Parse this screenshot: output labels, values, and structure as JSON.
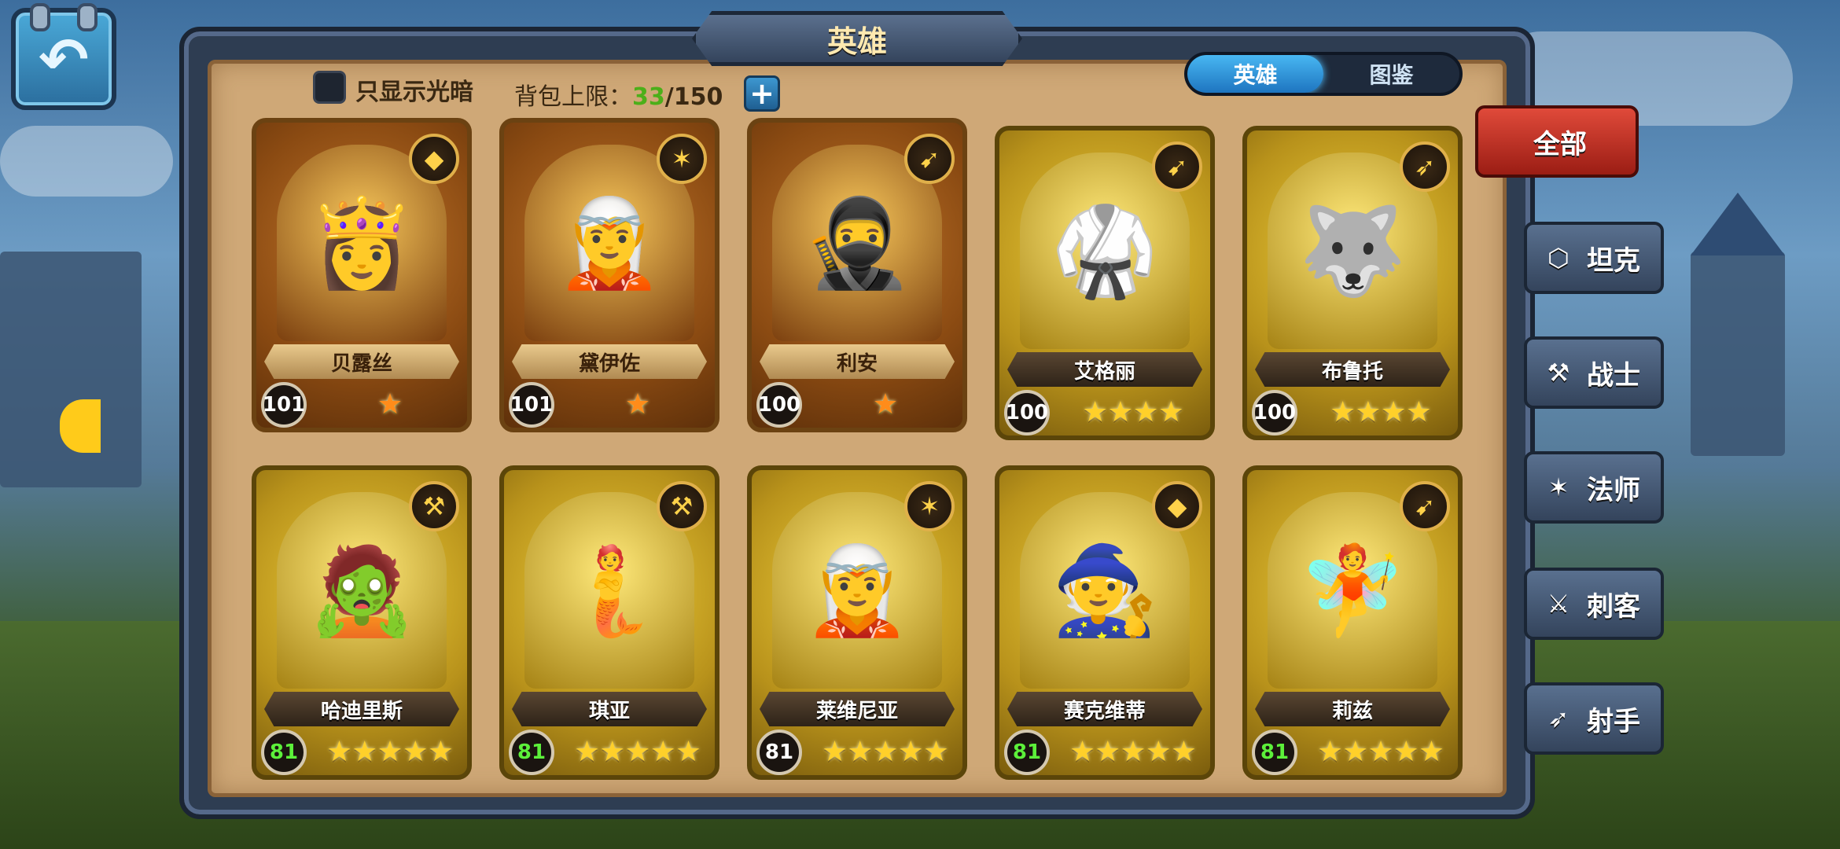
{
  "header": {
    "title": "英雄"
  },
  "filter": {
    "only_light_dark_label": "只显示光暗",
    "bag_label": "背包上限：",
    "bag_current": "33",
    "bag_max": "/150",
    "expand_symbol": "+"
  },
  "tabs": [
    {
      "label": "英雄",
      "active": true
    },
    {
      "label": "图鉴",
      "active": false
    }
  ],
  "categories": [
    {
      "label": "全部",
      "icon": "grid-icon",
      "active": true
    },
    {
      "label": "坦克",
      "icon": "shield-icon",
      "active": false
    },
    {
      "label": "战士",
      "icon": "hammer-icon",
      "active": false
    },
    {
      "label": "法师",
      "icon": "staff-icon",
      "active": false
    },
    {
      "label": "刺客",
      "icon": "dagger-icon",
      "active": false
    },
    {
      "label": "射手",
      "icon": "bow-icon",
      "active": false
    }
  ],
  "heroes": [
    {
      "name": "贝露丝",
      "level": "101",
      "stars": "★",
      "frame": "bronze",
      "class_icon": "gem-icon",
      "level_color": "white"
    },
    {
      "name": "黛伊佐",
      "level": "101",
      "stars": "★",
      "frame": "bronze",
      "class_icon": "staff-icon",
      "level_color": "white"
    },
    {
      "name": "利安",
      "level": "100",
      "stars": "★",
      "frame": "bronze",
      "class_icon": "arrow-icon",
      "level_color": "white"
    },
    {
      "name": "艾格丽",
      "level": "100",
      "stars": "★★★★",
      "frame": "gold",
      "class_icon": "arrow-icon",
      "level_color": "white"
    },
    {
      "name": "布鲁托",
      "level": "100",
      "stars": "★★★★",
      "frame": "gold",
      "class_icon": "bow-icon",
      "level_color": "white"
    },
    {
      "name": "哈迪里斯",
      "level": "81",
      "stars": "★★★★★",
      "frame": "gold",
      "class_icon": "hammer-icon",
      "level_color": "green"
    },
    {
      "name": "琪亚",
      "level": "81",
      "stars": "★★★★★",
      "frame": "gold",
      "class_icon": "hammer-icon",
      "level_color": "green"
    },
    {
      "name": "莱维尼亚",
      "level": "81",
      "stars": "★★★★★",
      "frame": "gold",
      "class_icon": "staff-icon",
      "level_color": "white"
    },
    {
      "name": "赛克维蒂",
      "level": "81",
      "stars": "★★★★★",
      "frame": "gold",
      "class_icon": "gem-icon",
      "level_color": "green"
    },
    {
      "name": "莉兹",
      "level": "81",
      "stars": "★★★★★",
      "frame": "gold",
      "class_icon": "arrow-icon",
      "level_color": "green"
    }
  ]
}
